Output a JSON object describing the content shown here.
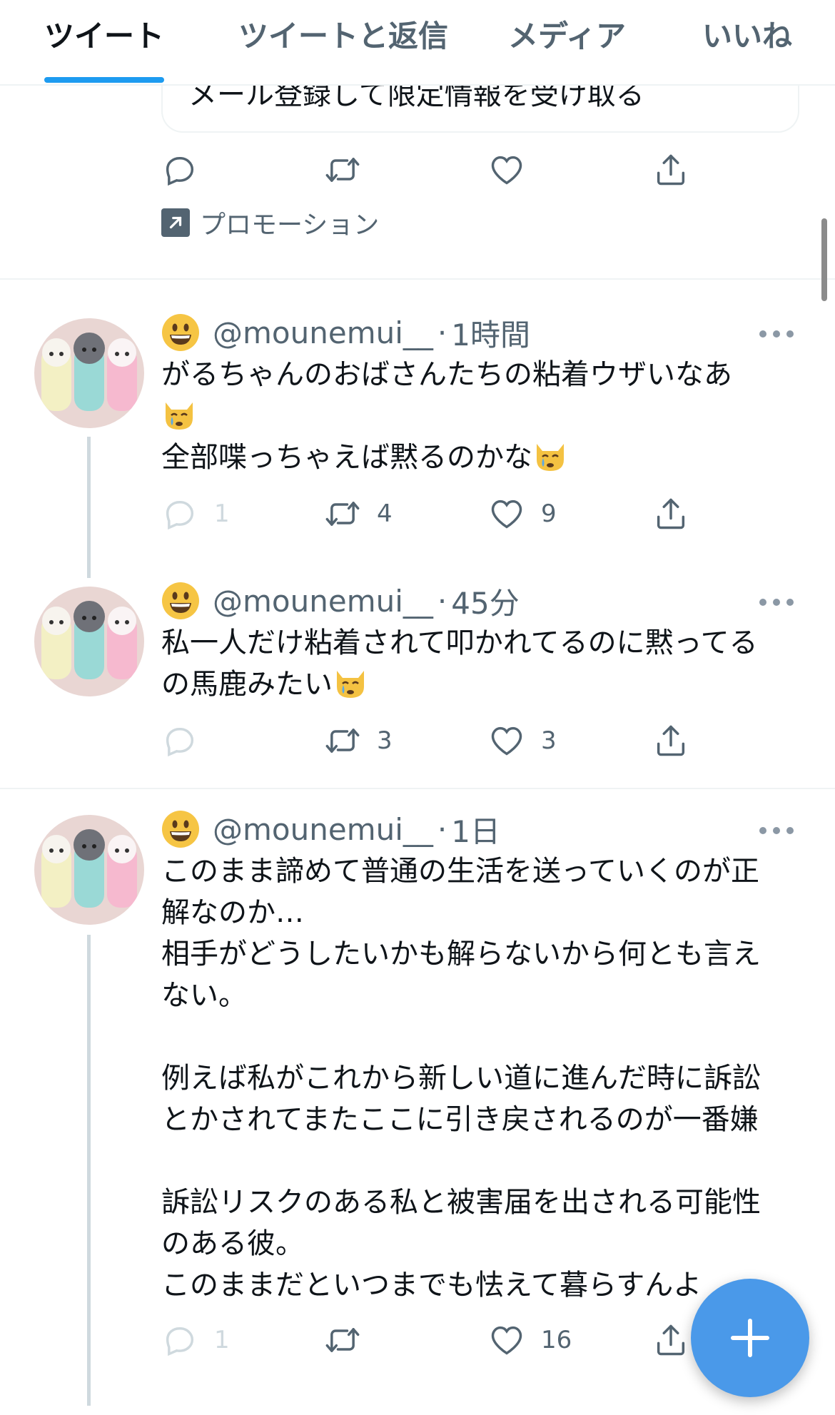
{
  "tabs": [
    {
      "label": "ツイート",
      "active": true
    },
    {
      "label": "ツイートと返信",
      "active": false
    },
    {
      "label": "メディア",
      "active": false
    },
    {
      "label": "いいね",
      "active": false
    }
  ],
  "promo": {
    "card_text": "メール登録して限定情報を受け取る",
    "label": "プロモーション"
  },
  "tweets": [
    {
      "handle": "@mounemui__",
      "time": "1時間",
      "lines": [
        "がるちゃんのおばさんたちの粘着ウザいなあ",
        "全部喋っちゃえば黙るのかな"
      ],
      "reply_count": "1",
      "retweet_count": "4",
      "like_count": "9"
    },
    {
      "handle": "@mounemui__",
      "time": "45分",
      "lines": [
        "私一人だけ粘着されて叩かれてるのに黙ってる",
        "の馬鹿みたい"
      ],
      "reply_count": "",
      "retweet_count": "3",
      "like_count": "3"
    },
    {
      "handle": "@mounemui__",
      "time": "1日",
      "text": "このまま諦めて普通の生活を送っていくのが正\n解なのか…\n相手がどうしたいかも解らないから何とも言え\nない。\n\n例えば私がこれから新しい道に進んだ時に訴訟\nとかされてまたここに引き戻されるのが一番嫌\n\n訴訟リスクのある私と被害届を出される可能性\nのある彼。\nこのままだといつまでも怯えて暮らすんよ",
      "reply_count": "1",
      "retweet_count": "",
      "like_count": "16"
    }
  ],
  "icons": {
    "reply": "reply-icon",
    "retweet": "retweet-icon",
    "like": "heart-icon",
    "share": "share-icon",
    "compose": "compose-plus-icon",
    "more": "more-icon"
  },
  "colors": {
    "accent": "#1d9bf0",
    "fab": "#4a99e9",
    "muted": "#536471"
  }
}
